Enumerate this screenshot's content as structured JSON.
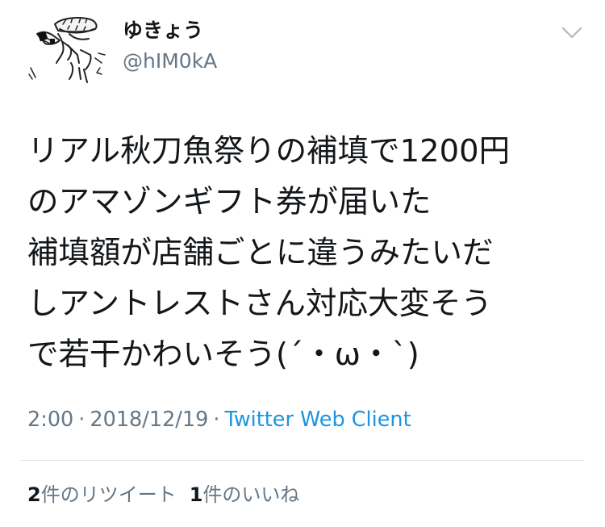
{
  "user": {
    "display_name": "ゆきょう",
    "handle": "@hIM0kA",
    "avatar_icon": "sketch-avatar-icon"
  },
  "menu": {
    "icon": "chevron-down-icon"
  },
  "tweet": {
    "lines": [
      "リアル秋刀魚祭りの補填で1200円",
      "のアマゾンギフト券が届いた",
      "補填額が店舗ごとに違うみたいだ",
      "しアントレストさん対応大変そう",
      "で若干かわいそう(´・ω・`)"
    ]
  },
  "meta": {
    "time": "2:00",
    "separator": "·",
    "date": "2018/12/19",
    "client": "Twitter Web Client"
  },
  "stats": {
    "retweets_count": "2",
    "retweets_label": "件のリツイート",
    "likes_count": "1",
    "likes_label": "件のいいね"
  }
}
